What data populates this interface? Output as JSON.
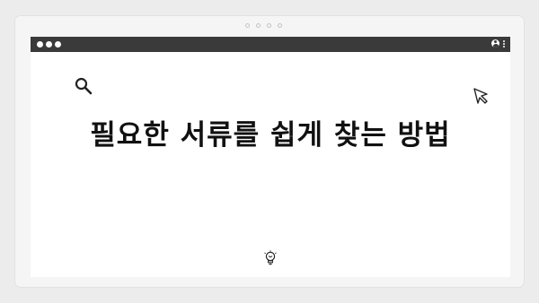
{
  "headline": "필요한 서류를 쉽게 찾는 방법",
  "icons": {
    "search": "search-icon",
    "cursor": "cursor-icon",
    "idea": "lightbulb-icon",
    "profile": "user-icon",
    "menu": "kebab-menu-icon"
  },
  "colors": {
    "background": "#ececec",
    "browser_bar": "#3a3a3a",
    "content": "#ffffff",
    "text": "#111111"
  }
}
